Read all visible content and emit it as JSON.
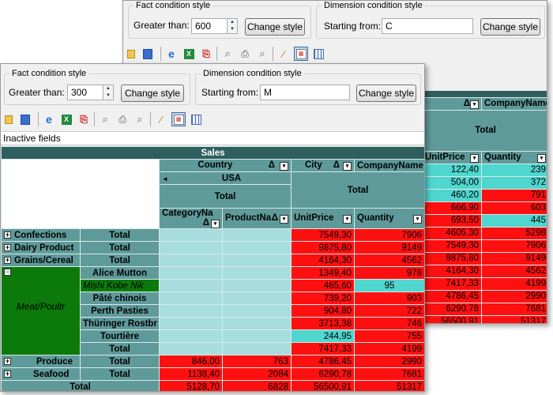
{
  "back": {
    "fact_legend": "Fact condition style",
    "greater_label": "Greater than:",
    "greater_value": "600",
    "change_label": "Change style",
    "dim_legend": "Dimension condition style",
    "starting_label": "Starting from:",
    "starting_value": "C",
    "col_unitprice": "UnitPrice",
    "col_quantity": "Quantity",
    "companyname": "CompanyName",
    "total": "Total",
    "rows": [
      [
        "122,40",
        "239"
      ],
      [
        "504,00",
        "372"
      ],
      [
        "460,20",
        "791"
      ],
      [
        "666,90",
        "603"
      ],
      [
        "693,50",
        "445"
      ],
      [
        "4605,30",
        "5298"
      ],
      [
        "7549,30",
        "7906"
      ],
      [
        "9875,80",
        "9149"
      ],
      [
        "4164,30",
        "4562"
      ],
      [
        "7417,33",
        "4199"
      ],
      [
        "4786,45",
        "2990"
      ],
      [
        "6290,78",
        "7681"
      ],
      [
        "56500,91",
        "51317"
      ]
    ]
  },
  "front": {
    "fact_legend": "Fact condition style",
    "greater_label": "Greater than:",
    "greater_value": "300",
    "change_label": "Change style",
    "dim_legend": "Dimension condition style",
    "starting_label": "Starting from:",
    "starting_value": "M",
    "inactive_fields": "Inactive fields",
    "sales": "Sales",
    "country": "Country",
    "city": "City",
    "companyname": "CompanyName",
    "usa": "USA",
    "total": "Total",
    "categoryname": "CategoryNa",
    "productname": "ProductNa",
    "unitprice": "UnitPrice",
    "quantity": "Quantity",
    "confections": "Confections",
    "dairy": "Dairy Product",
    "grains": "Grains/Cereal",
    "meat": "Meat/Poultr",
    "produce": "Produce",
    "seafood": "Seafood",
    "p1": "Alice Mutton",
    "p2": "Mishi Kobe Nik",
    "p3": "Pâté chinois",
    "p4": "Perth Pasties",
    "p5": "Thüringer Rostbr",
    "p6": "Tourtière",
    "v": {
      "conf": [
        "7549,30",
        "7906"
      ],
      "dairy": [
        "9875,80",
        "9149"
      ],
      "grains": [
        "4164,30",
        "4562"
      ],
      "p1": [
        "1349,40",
        "978"
      ],
      "p2": [
        "465,60",
        "95"
      ],
      "p3": [
        "739,20",
        "903"
      ],
      "p4": [
        "904,80",
        "722"
      ],
      "p5": [
        "3713,38",
        "746"
      ],
      "p6": [
        "244,95",
        "755"
      ],
      "meat_total": [
        "7417,33",
        "4199"
      ],
      "produce_usa": [
        "846,00",
        "763"
      ],
      "produce": [
        "4786,45",
        "2990"
      ],
      "seafood_usa": [
        "1138,40",
        "2084"
      ],
      "seafood": [
        "6290,78",
        "7681"
      ],
      "grand_usa": [
        "5128,70",
        "6828"
      ],
      "grand": [
        "56500,91",
        "51317"
      ]
    }
  }
}
